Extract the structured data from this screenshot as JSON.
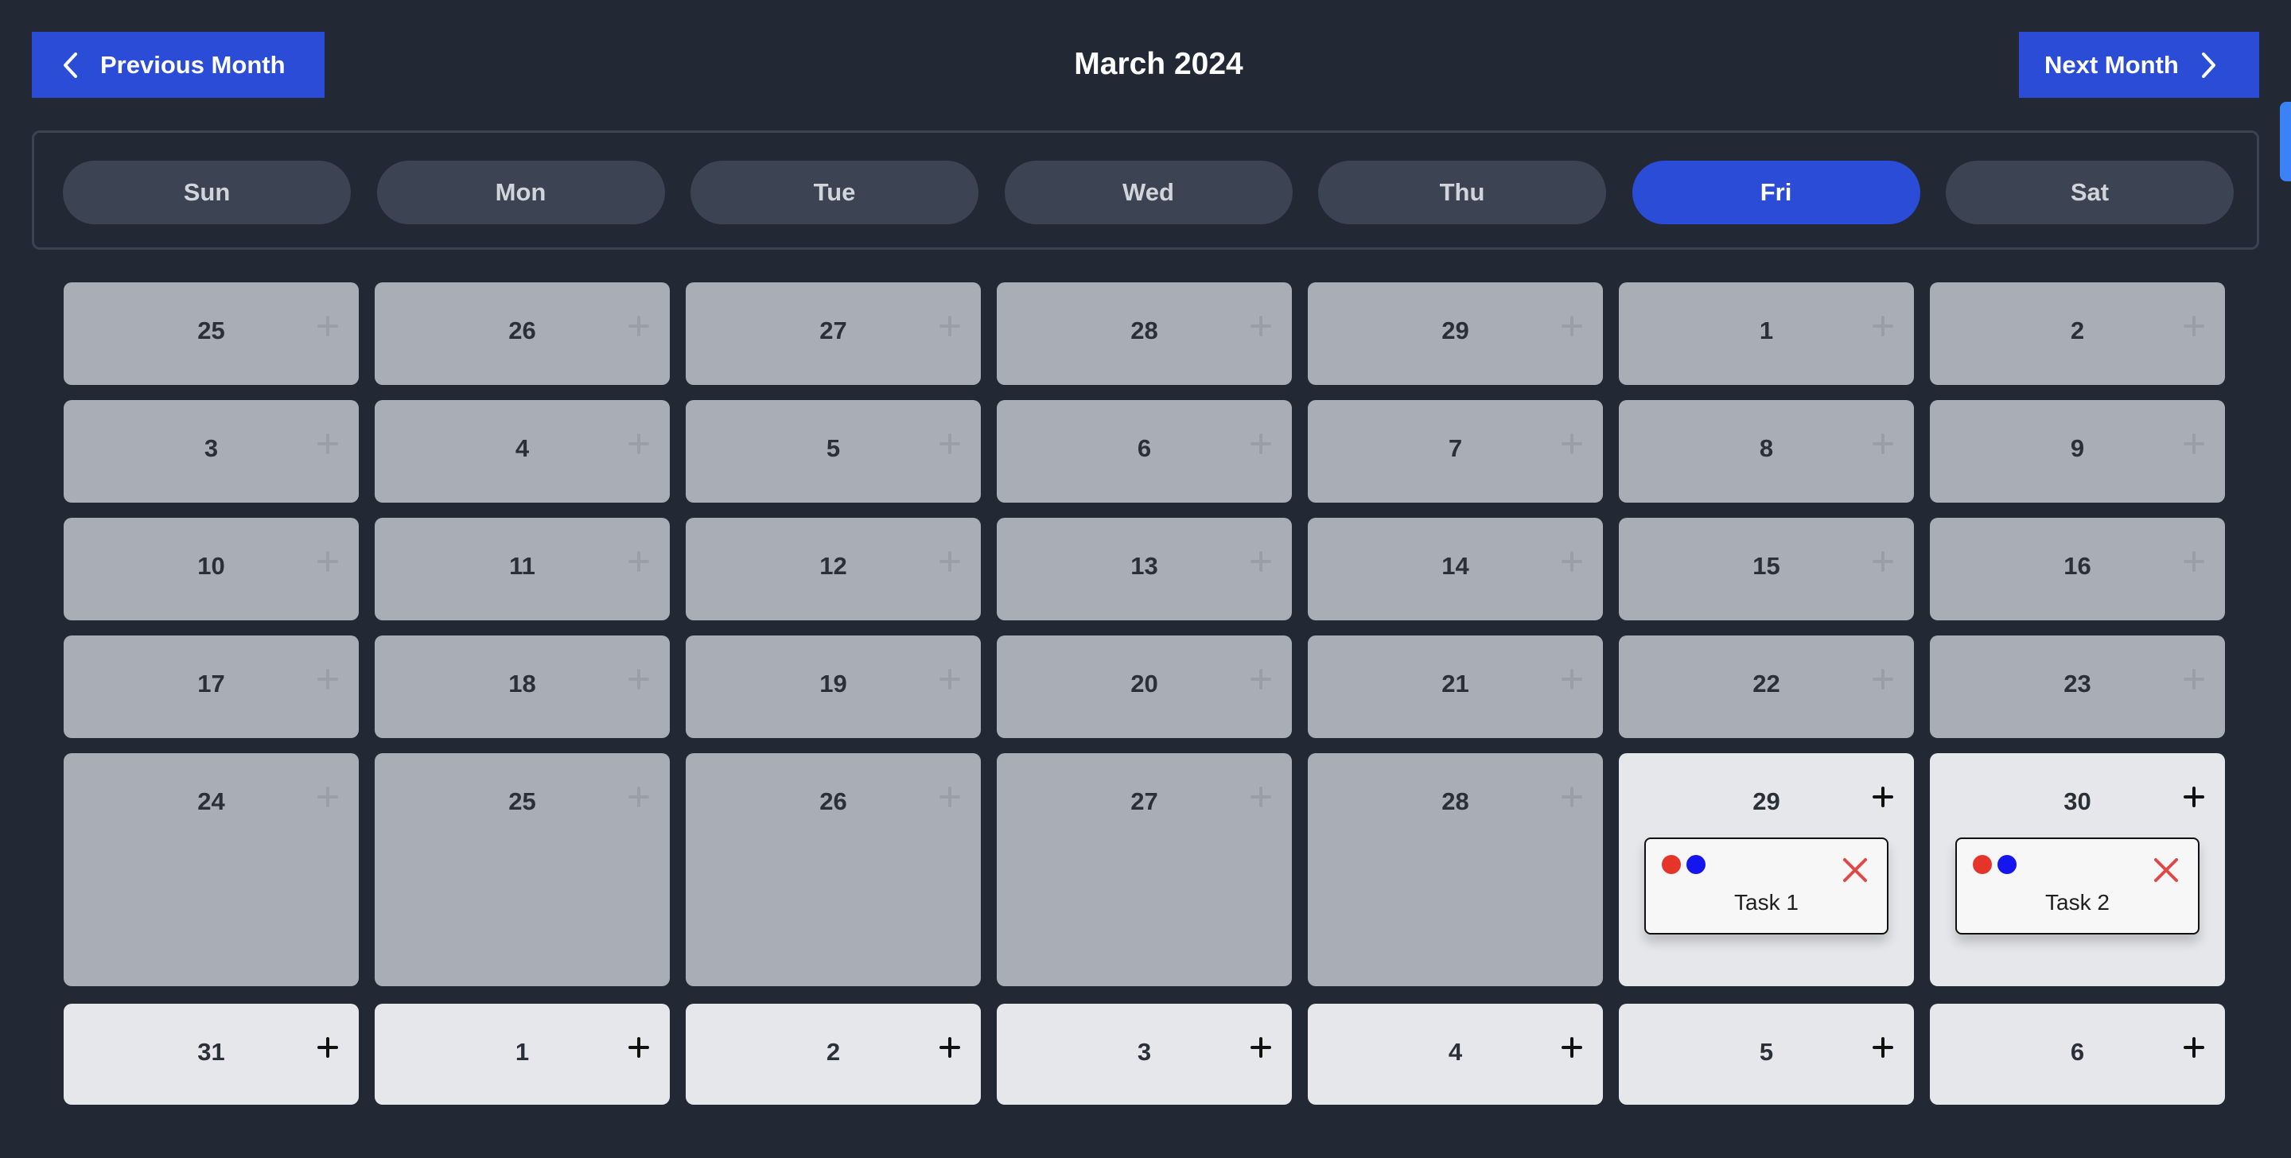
{
  "header": {
    "prev_label": "Previous Month",
    "next_label": "Next Month",
    "title": "March 2024"
  },
  "weekdays": {
    "items": [
      {
        "label": "Sun",
        "active": false
      },
      {
        "label": "Mon",
        "active": false
      },
      {
        "label": "Tue",
        "active": false
      },
      {
        "label": "Wed",
        "active": false
      },
      {
        "label": "Thu",
        "active": false
      },
      {
        "label": "Fri",
        "active": true
      },
      {
        "label": "Sat",
        "active": false
      }
    ]
  },
  "calendar": {
    "weeks": [
      [
        {
          "day": "25",
          "active": false
        },
        {
          "day": "26",
          "active": false
        },
        {
          "day": "27",
          "active": false
        },
        {
          "day": "28",
          "active": false
        },
        {
          "day": "29",
          "active": false
        },
        {
          "day": "1",
          "active": false
        },
        {
          "day": "2",
          "active": false
        }
      ],
      [
        {
          "day": "3",
          "active": false
        },
        {
          "day": "4",
          "active": false
        },
        {
          "day": "5",
          "active": false
        },
        {
          "day": "6",
          "active": false
        },
        {
          "day": "7",
          "active": false
        },
        {
          "day": "8",
          "active": false
        },
        {
          "day": "9",
          "active": false
        }
      ],
      [
        {
          "day": "10",
          "active": false
        },
        {
          "day": "11",
          "active": false
        },
        {
          "day": "12",
          "active": false
        },
        {
          "day": "13",
          "active": false
        },
        {
          "day": "14",
          "active": false
        },
        {
          "day": "15",
          "active": false
        },
        {
          "day": "16",
          "active": false
        }
      ],
      [
        {
          "day": "17",
          "active": false
        },
        {
          "day": "18",
          "active": false
        },
        {
          "day": "19",
          "active": false
        },
        {
          "day": "20",
          "active": false
        },
        {
          "day": "21",
          "active": false
        },
        {
          "day": "22",
          "active": false
        },
        {
          "day": "23",
          "active": false
        }
      ],
      [
        {
          "day": "24",
          "active": false
        },
        {
          "day": "25",
          "active": false
        },
        {
          "day": "26",
          "active": false
        },
        {
          "day": "27",
          "active": false
        },
        {
          "day": "28",
          "active": false
        },
        {
          "day": "29",
          "active": true,
          "task": "Task 1"
        },
        {
          "day": "30",
          "active": true,
          "task": "Task 2"
        }
      ],
      [
        {
          "day": "31",
          "active": true
        },
        {
          "day": "1",
          "active": true
        },
        {
          "day": "2",
          "active": true
        },
        {
          "day": "3",
          "active": true
        },
        {
          "day": "4",
          "active": true
        },
        {
          "day": "5",
          "active": true
        },
        {
          "day": "6",
          "active": true
        }
      ]
    ]
  },
  "icons": {
    "prev": "chevron-left-icon",
    "next": "chevron-right-icon",
    "add": "plus-icon",
    "close": "close-icon",
    "tag": "color-dot-icon"
  },
  "colors": {
    "background": "#222935",
    "accent": "#2a4cd7",
    "cell_inactive": "#a9adb6",
    "cell_active": "#e6e7eb",
    "plus_inactive": "#9a9ea7",
    "plus_active": "#111111",
    "close": "#e04848",
    "dot_red": "#e5342a",
    "dot_blue": "#1515f0"
  }
}
